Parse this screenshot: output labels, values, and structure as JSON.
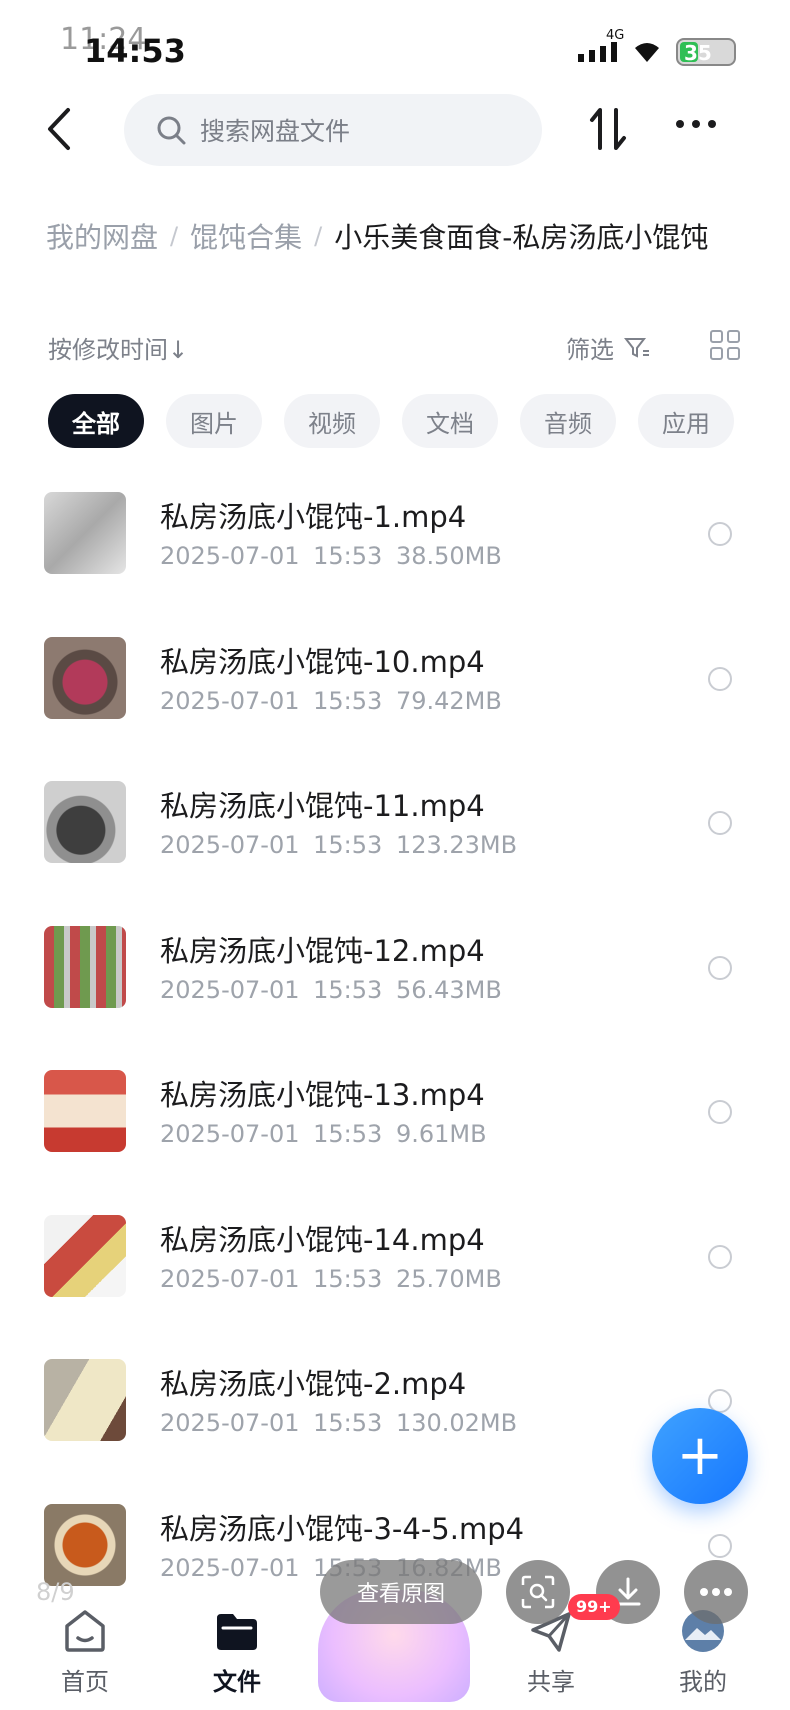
{
  "status_bar": {
    "ghost_time": "11:24",
    "time": "14:53",
    "network": "4G",
    "battery": "35"
  },
  "top_bar": {
    "search_placeholder": "搜索网盘文件"
  },
  "breadcrumb": {
    "root": "我的网盘",
    "parent": "馄饨合集",
    "current": "小乐美食面食-私房汤底小馄饨"
  },
  "toolbar": {
    "sort_label": "按修改时间↓",
    "filter_label": "筛选"
  },
  "tabs": [
    "全部",
    "图片",
    "视频",
    "文档",
    "音频",
    "应用"
  ],
  "files": [
    {
      "name": "私房汤底小馄饨-1.mp4",
      "date": "2025-07-01",
      "time": "15:53",
      "size": "38.50MB"
    },
    {
      "name": "私房汤底小馄饨-10.mp4",
      "date": "2025-07-01",
      "time": "15:53",
      "size": "79.42MB"
    },
    {
      "name": "私房汤底小馄饨-11.mp4",
      "date": "2025-07-01",
      "time": "15:53",
      "size": "123.23MB"
    },
    {
      "name": "私房汤底小馄饨-12.mp4",
      "date": "2025-07-01",
      "time": "15:53",
      "size": "56.43MB"
    },
    {
      "name": "私房汤底小馄饨-13.mp4",
      "date": "2025-07-01",
      "time": "15:53",
      "size": "9.61MB"
    },
    {
      "name": "私房汤底小馄饨-14.mp4",
      "date": "2025-07-01",
      "time": "15:53",
      "size": "25.70MB"
    },
    {
      "name": "私房汤底小馄饨-2.mp4",
      "date": "2025-07-01",
      "time": "15:53",
      "size": "130.02MB"
    },
    {
      "name": "私房汤底小馄饨-3-4-5.mp4",
      "date": "2025-07-01",
      "time": "15:53",
      "size": "16.82MB"
    }
  ],
  "overlay": {
    "page_counter": "8/9",
    "view_original": "查看原图",
    "badge": "99+"
  },
  "bottom_nav": {
    "home": "首页",
    "files": "文件",
    "share": "共享",
    "mine": "我的"
  },
  "colors": {
    "accent": "#1677ff",
    "active_tab": "#0f1420",
    "badge": "#ff3b4e"
  }
}
